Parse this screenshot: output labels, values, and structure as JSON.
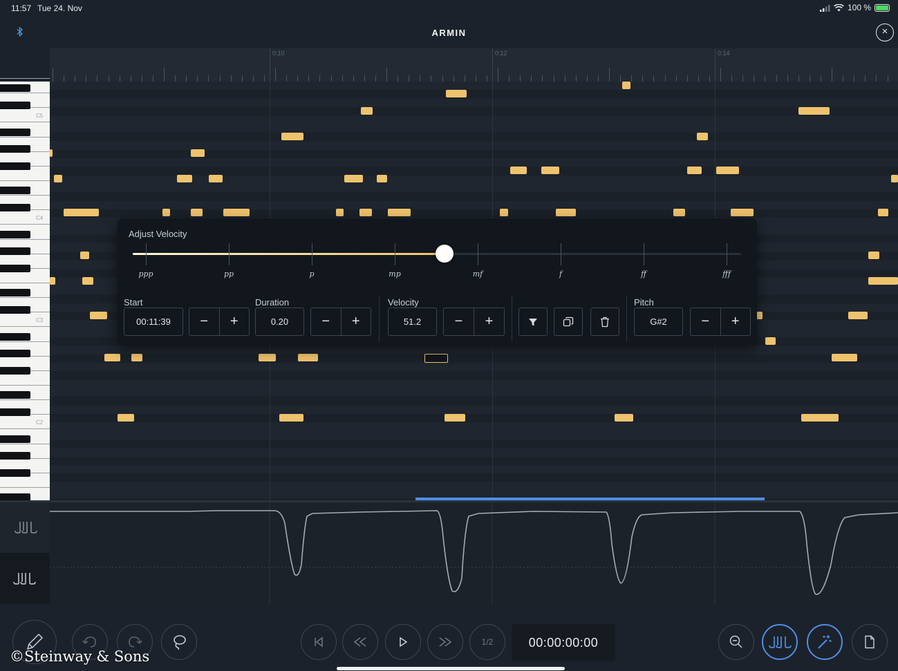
{
  "status_bar": {
    "time": "11:57",
    "date": "Tue 24. Nov",
    "battery": "100 %"
  },
  "header": {
    "title": "ARMIN",
    "bluetooth_icon": "bluetooth-icon",
    "close_icon": "close-icon"
  },
  "timeline": {
    "markers": [
      "0:10",
      "0:12",
      "0:14"
    ]
  },
  "keyboard": {
    "octave_labels": [
      "C5",
      "C4",
      "C3",
      "C2"
    ]
  },
  "velocity_panel": {
    "title": "Adjust Velocity",
    "dynamics": [
      "ppp",
      "pp",
      "p",
      "mp",
      "mf",
      "f",
      "ff",
      "fff"
    ],
    "slider_fraction": 0.513,
    "start": {
      "label": "Start",
      "value": "00:11:39"
    },
    "duration": {
      "label": "Duration",
      "value": "0.20"
    },
    "velocity": {
      "label": "Velocity",
      "value": "51.2"
    },
    "pitch": {
      "label": "Pitch",
      "value": "G#2"
    },
    "stepper": {
      "minus": "−",
      "plus": "+"
    },
    "tools": [
      "filter-icon",
      "copy-icon",
      "trash-icon"
    ]
  },
  "transport": {
    "timecode": "00:00:00:00",
    "half_speed": "1/2"
  },
  "watermark": "©Steinway & Sons",
  "colors": {
    "note": "#efc36d",
    "accent": "#4e8fe6",
    "background": "#1c222b"
  }
}
